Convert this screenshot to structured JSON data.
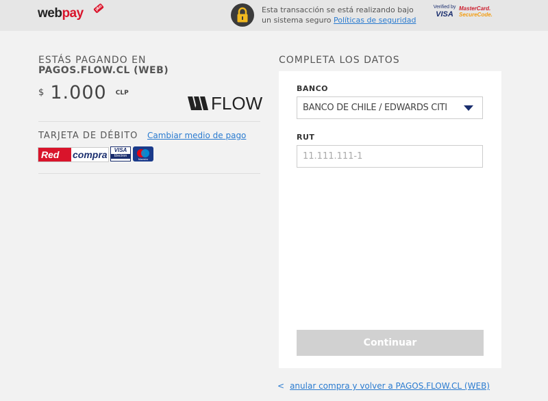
{
  "header": {
    "logo": {
      "main": "webpay",
      "badge": "plus"
    },
    "security": {
      "text": "Esta transacción se está realizando bajo un sistema seguro",
      "link": "Políticas de seguridad"
    },
    "verified_visa": {
      "top": "Verified by",
      "brand": "VISA"
    },
    "mastercard": {
      "line1": "MasterCard.",
      "line2": "SecureCode."
    }
  },
  "payment": {
    "paying_label": "ESTÁS PAGANDO EN",
    "merchant": "PAGOS.FLOW.CL (WEB)",
    "currency_symbol": "$",
    "amount": "1.000",
    "currency_code": "CLP",
    "merchant_logo": "FLOW",
    "card_type": "TARJETA DE DÉBITO",
    "change_method": "Cambiar medio de pago",
    "card_logos": {
      "redcompra_red": "Red",
      "redcompra_compra": "compra",
      "visa": "VISA",
      "electron": "Electron",
      "maestro": "Maestro"
    }
  },
  "form": {
    "title": "COMPLETA LOS DATOS",
    "bank_label": "BANCO",
    "bank_value": "BANCO DE CHILE / EDWARDS CITI",
    "rut_label": "RUT",
    "rut_placeholder": "11.111.111-1",
    "continue": "Continuar"
  },
  "footer": {
    "back_chevron": "<",
    "back_link": "anular compra y volver a PAGOS.FLOW.CL (WEB)"
  },
  "colors": {
    "accent_red": "#d9142b",
    "link_blue": "#2a7bd0",
    "disabled_button": "#d1d1d1",
    "topbar_bg": "#e6e6e6"
  }
}
